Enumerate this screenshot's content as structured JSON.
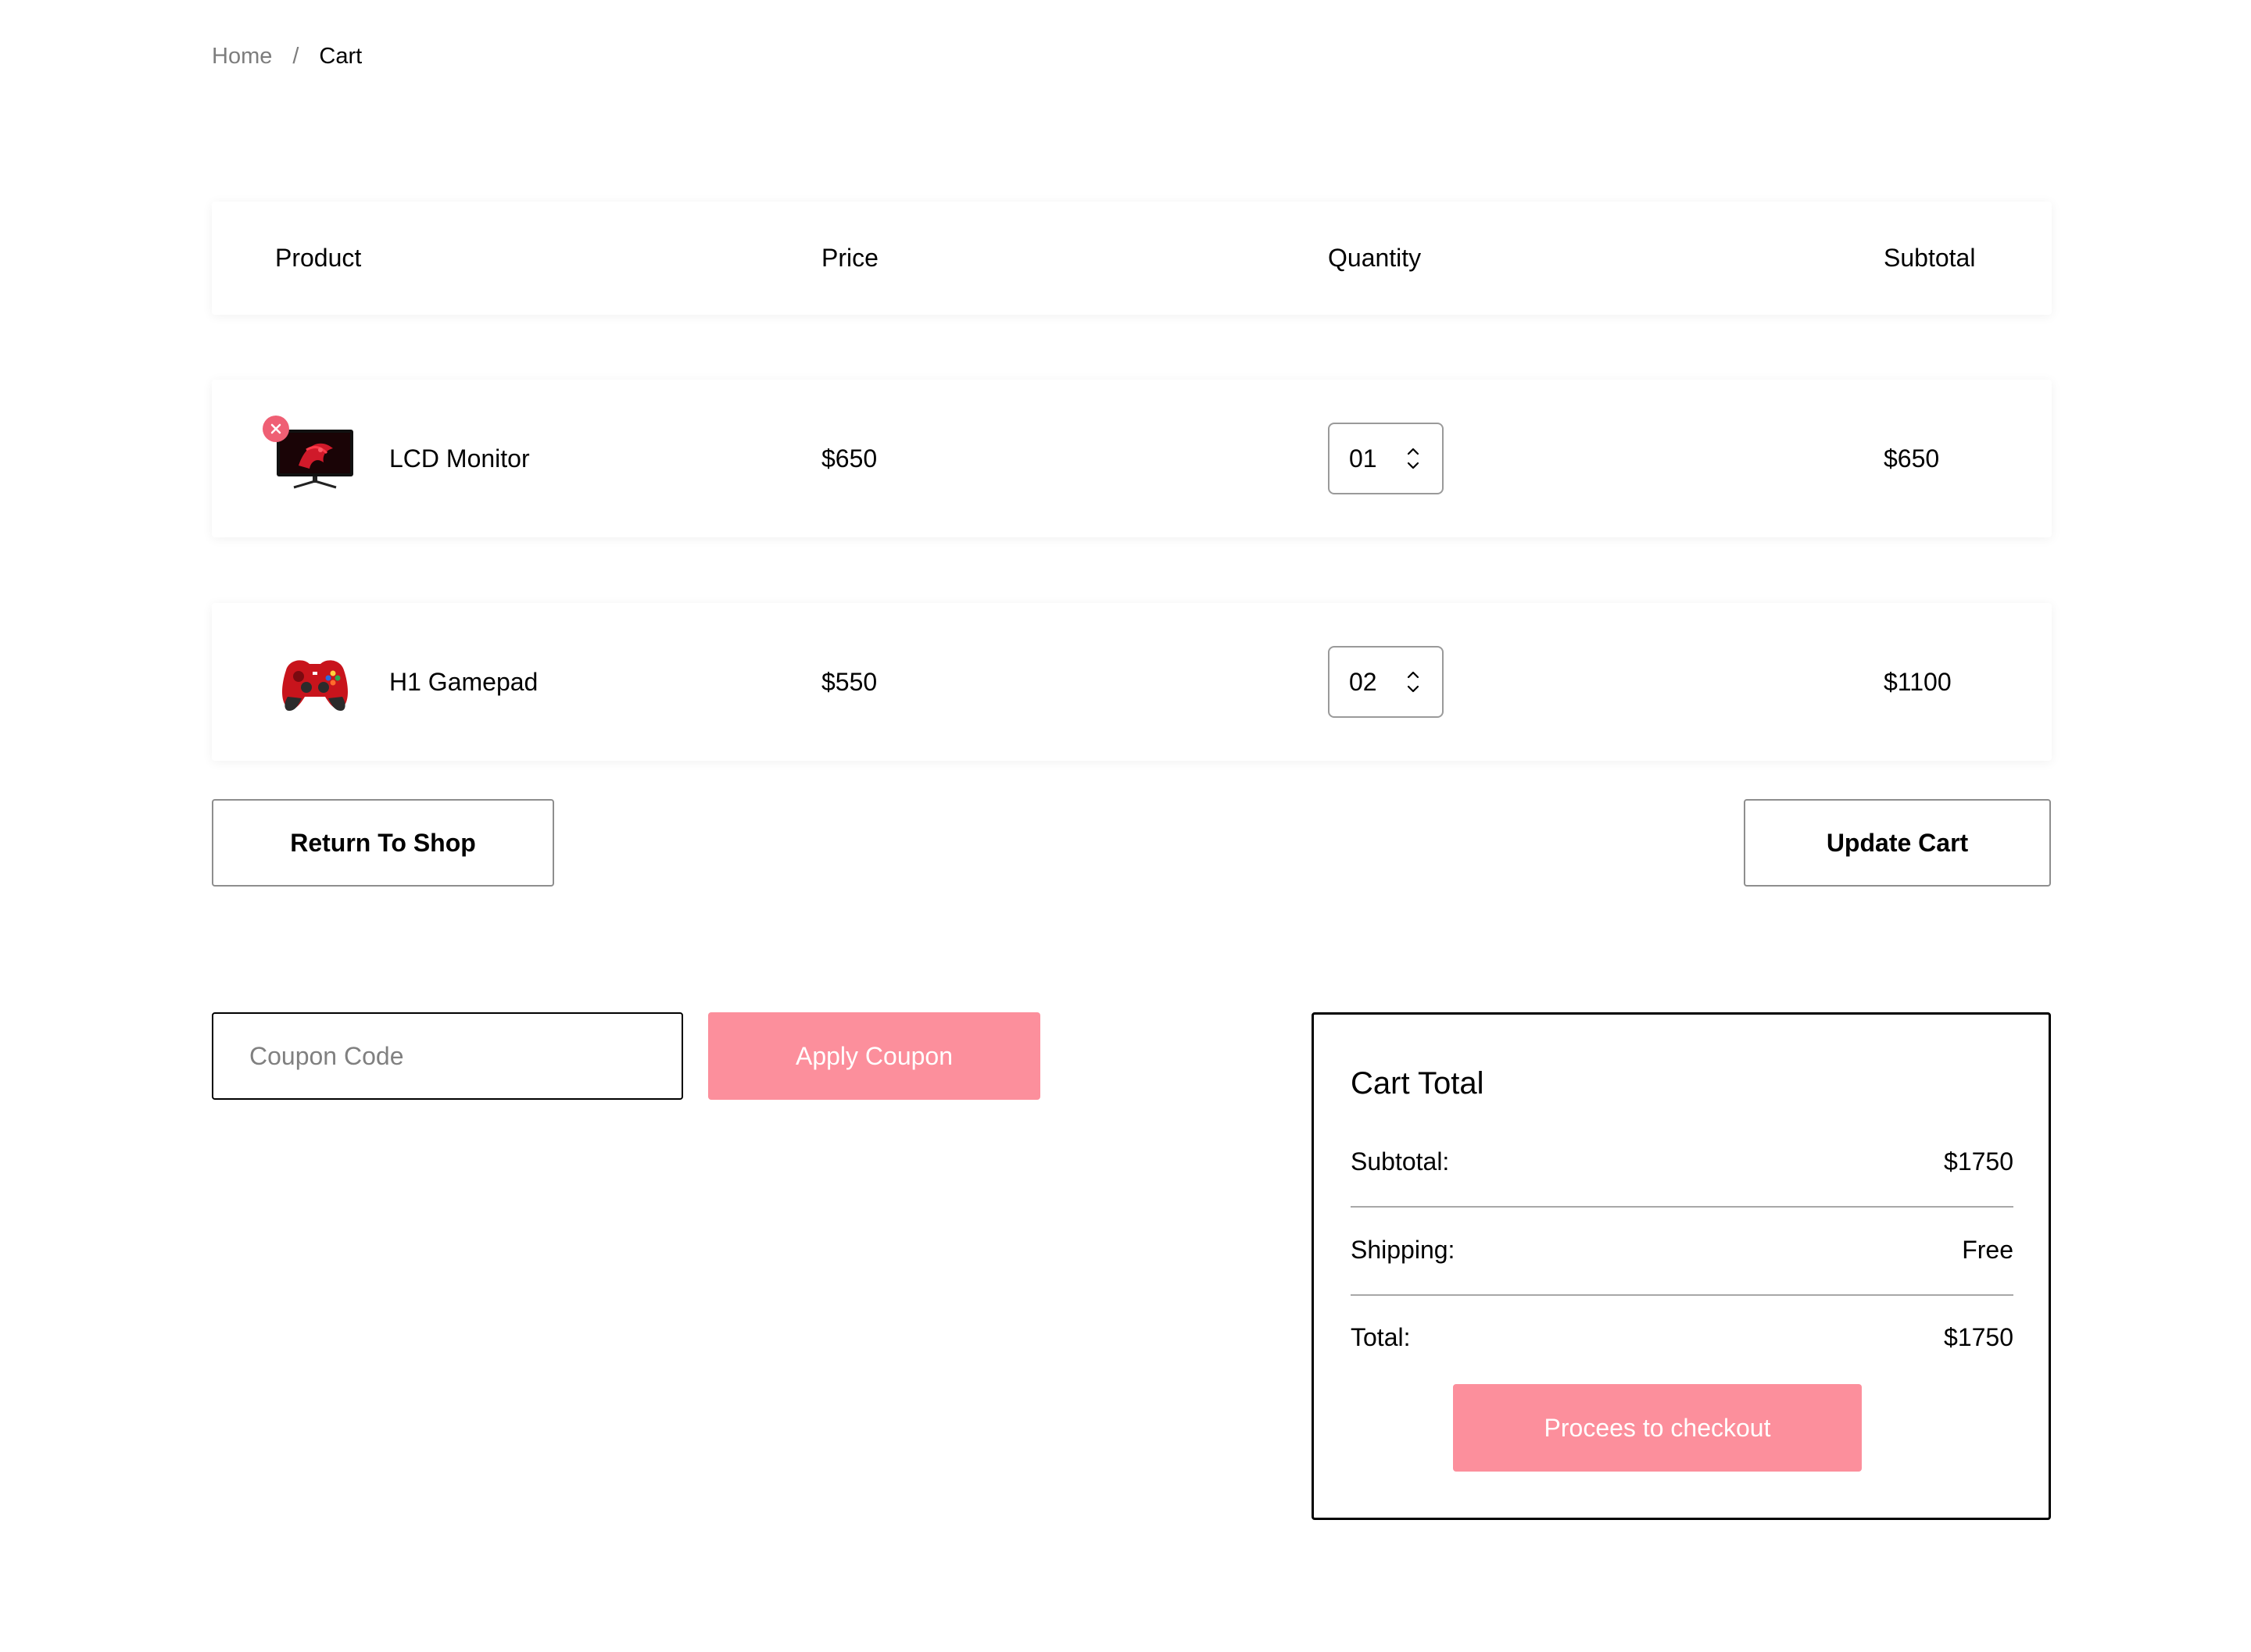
{
  "breadcrumb": {
    "home": "Home",
    "separator": "/",
    "current": "Cart"
  },
  "table": {
    "headers": {
      "product": "Product",
      "price": "Price",
      "quantity": "Quantity",
      "subtotal": "Subtotal"
    },
    "rows": [
      {
        "name": "LCD Monitor",
        "price": "$650",
        "quantity": "01",
        "subtotal": "$650",
        "image_icon": "monitor-image",
        "removable": true
      },
      {
        "name": "H1 Gamepad",
        "price": "$550",
        "quantity": "02",
        "subtotal": "$1100",
        "image_icon": "gamepad-image",
        "removable": false
      }
    ]
  },
  "actions": {
    "return_label": "Return To Shop",
    "update_label": "Update Cart"
  },
  "coupon": {
    "placeholder": "Coupon Code",
    "apply_label": "Apply Coupon"
  },
  "cart_total": {
    "title": "Cart Total",
    "subtotal_label": "Subtotal:",
    "subtotal_value": "$1750",
    "shipping_label": "Shipping:",
    "shipping_value": "Free",
    "total_label": "Total:",
    "total_value": "$1750",
    "checkout_label": "Procees to checkout"
  },
  "colors": {
    "accent": "#FC8F9C",
    "remove": "#EF5F74",
    "muted_text": "#7D7D7D"
  }
}
